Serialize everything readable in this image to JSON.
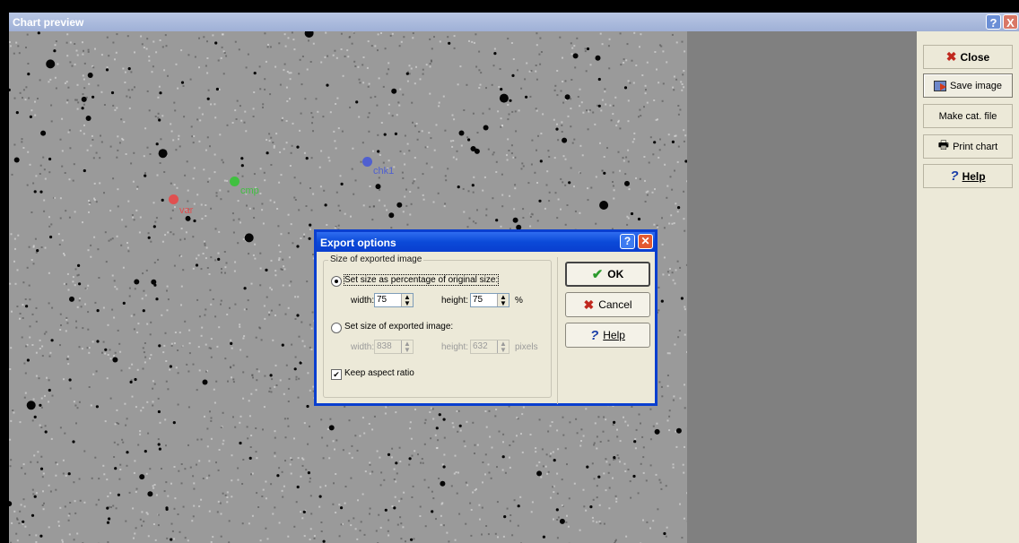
{
  "window": {
    "title": "Chart preview",
    "help_glyph": "?",
    "close_glyph": "X"
  },
  "markers": [
    {
      "label": "var",
      "color": "#e05050"
    },
    {
      "label": "cmp",
      "color": "#40c040"
    },
    {
      "label": "chk1",
      "color": "#5060d0"
    }
  ],
  "sidebar": {
    "close_label": "Close",
    "save_label": "Save image",
    "catfile_label": "Make cat. file",
    "print_label": "Print chart",
    "help_label": "Help",
    "icon_names": [
      "close-icon",
      "save-icon",
      "printer-icon",
      "help-icon"
    ]
  },
  "dialog": {
    "title": "Export options",
    "group_title": "Size of exported image",
    "radio_percent_label": "Set size as percentage of original size:",
    "radio_pixels_label": "Set size of exported image:",
    "width_label": "width:",
    "height_label": "height:",
    "percent_width": "75",
    "percent_height": "75",
    "percent_unit": "%",
    "pixel_width": "838",
    "pixel_height": "632",
    "pixel_unit": "pixels",
    "keep_aspect_label": "Keep aspect ratio",
    "keep_aspect_checked": true,
    "ok_label": "OK",
    "cancel_label": "Cancel",
    "help_label": "Help"
  }
}
